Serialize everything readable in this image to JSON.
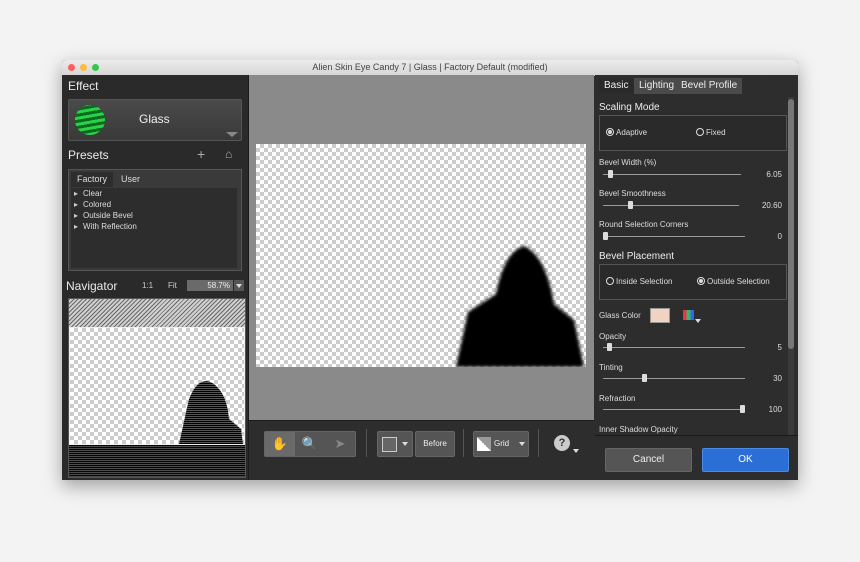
{
  "window": {
    "title": "Alien Skin Eye Candy 7 | Glass | Factory Default (modified)"
  },
  "effect": {
    "heading": "Effect",
    "selected": "Glass"
  },
  "presets": {
    "heading": "Presets",
    "tabs": [
      "Factory",
      "User"
    ],
    "items": [
      "Clear",
      "Colored",
      "Outside Bevel",
      "With Reflection"
    ]
  },
  "navigator": {
    "heading": "Navigator",
    "one_to_one": "1:1",
    "fit": "Fit",
    "zoom": "58.7%"
  },
  "toolbar": {
    "before_label": "Before",
    "grid_label": "Grid",
    "help": "?"
  },
  "tabs": [
    "Basic",
    "Lighting",
    "Bevel Profile"
  ],
  "scaling_mode": {
    "heading": "Scaling Mode",
    "options": [
      "Adaptive",
      "Fixed"
    ],
    "selected": "Adaptive"
  },
  "params": [
    {
      "label": "Bevel Width (%)",
      "value": "6.05",
      "fraction": 0.05
    },
    {
      "label": "Bevel Smoothness",
      "value": "20.60",
      "fraction": 0.2
    },
    {
      "label": "Round Selection Corners",
      "value": "0",
      "fraction": 0.0
    }
  ],
  "bevel_placement": {
    "heading": "Bevel Placement",
    "options": [
      "Inside Selection",
      "Outside Selection"
    ],
    "selected": "Outside Selection"
  },
  "glass_color": {
    "label": "Glass Color",
    "value": "#f0d3c0"
  },
  "params2": [
    {
      "label": "Opacity",
      "value": "5",
      "fraction": 0.05
    },
    {
      "label": "Tinting",
      "value": "30",
      "fraction": 0.3
    },
    {
      "label": "Refraction",
      "value": "100",
      "fraction": 1.0
    },
    {
      "label": "Inner Shadow Opacity"
    }
  ],
  "buttons": {
    "cancel": "Cancel",
    "ok": "OK"
  }
}
